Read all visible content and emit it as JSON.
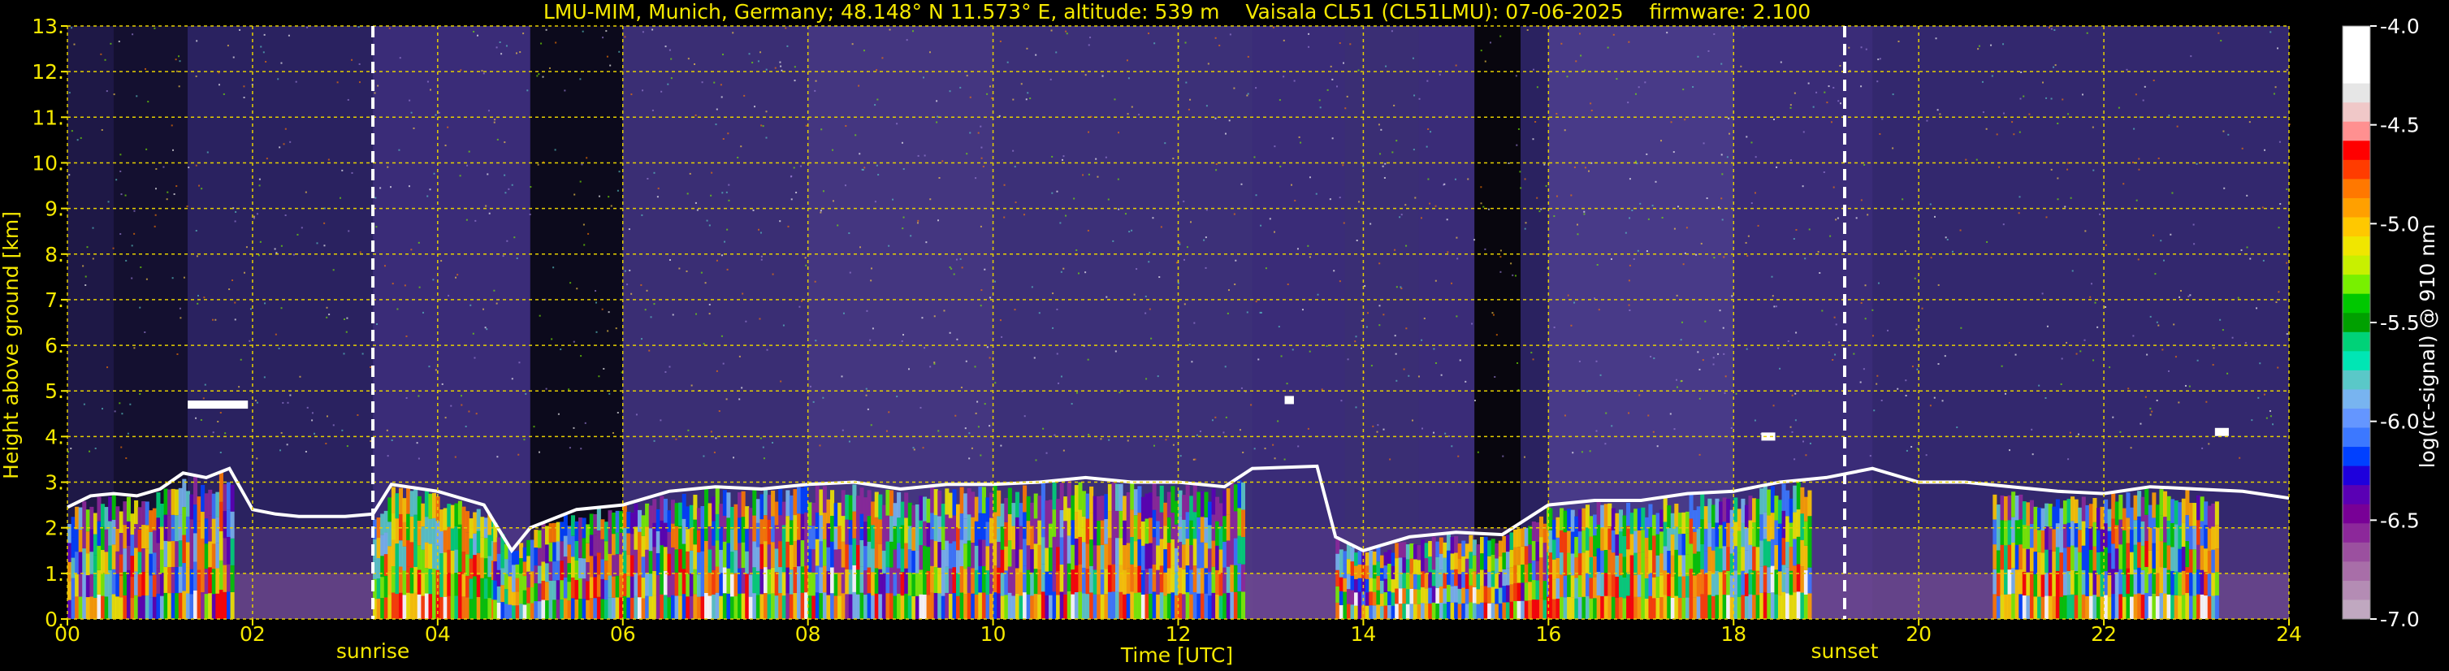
{
  "chart_data": {
    "type": "heatmap",
    "title": "LMU-MIM, Munich, Germany; 48.148° N 11.573° E, altitude: 539 m    Vaisala CL51 (CL51LMU): 07-06-2025    firmware: 2.100",
    "xlabel": "Time [UTC]",
    "ylabel": "Height above ground [km]",
    "xlim": [
      0,
      24
    ],
    "ylim": [
      0,
      13
    ],
    "x_ticks": [
      "00",
      "02",
      "04",
      "06",
      "08",
      "10",
      "12",
      "14",
      "16",
      "18",
      "20",
      "22",
      "24"
    ],
    "y_ticks": [
      "0.",
      "1.",
      "2.",
      "3.",
      "4.",
      "5.",
      "6.",
      "7.",
      "8.",
      "9.",
      "10.",
      "11.",
      "12.",
      "13."
    ],
    "grid": true,
    "colorbar": {
      "label": "log(rc-signal) @ 910 nm",
      "range": [
        -7.0,
        -4.0
      ],
      "ticks": [
        "-4.0",
        "-4.5",
        "-5.0",
        "-5.5",
        "-6.0",
        "-6.5",
        "-7.0"
      ],
      "colors": [
        "#ffffff",
        "#ffffff",
        "#ffffff",
        "#e6e6e6",
        "#f0c8c8",
        "#ff9090",
        "#ff0000",
        "#ff3c00",
        "#ff7800",
        "#ffa000",
        "#ffc800",
        "#f0e600",
        "#c8f000",
        "#78f000",
        "#00c800",
        "#00a000",
        "#00d278",
        "#00e6b4",
        "#5ac8c8",
        "#78b4f0",
        "#6496ff",
        "#3c78ff",
        "#0040ff",
        "#1e00dc",
        "#5a00b4",
        "#780096",
        "#8c289a",
        "#9b509f",
        "#a86ea8",
        "#b48cb4",
        "#c0a8c0"
      ]
    },
    "annotations": [
      {
        "label": "sunrise",
        "x": 3.3
      },
      {
        "label": "sunset",
        "x": 19.2
      }
    ],
    "cloud_layer_km": [
      {
        "t": 0.0,
        "h": 2.45
      },
      {
        "t": 0.25,
        "h": 2.7
      },
      {
        "t": 0.5,
        "h": 2.75
      },
      {
        "t": 0.75,
        "h": 2.7
      },
      {
        "t": 1.0,
        "h": 2.85
      },
      {
        "t": 1.25,
        "h": 3.2
      },
      {
        "t": 1.5,
        "h": 3.1
      },
      {
        "t": 1.75,
        "h": 3.3
      },
      {
        "t": 2.0,
        "h": 2.4
      },
      {
        "t": 2.25,
        "h": 2.3
      },
      {
        "t": 2.5,
        "h": 2.25
      },
      {
        "t": 3.0,
        "h": 2.25
      },
      {
        "t": 3.3,
        "h": 2.3
      },
      {
        "t": 3.5,
        "h": 2.95
      },
      {
        "t": 4.0,
        "h": 2.8
      },
      {
        "t": 4.5,
        "h": 2.5
      },
      {
        "t": 4.8,
        "h": 1.5
      },
      {
        "t": 5.0,
        "h": 2.0
      },
      {
        "t": 5.5,
        "h": 2.4
      },
      {
        "t": 6.0,
        "h": 2.5
      },
      {
        "t": 6.5,
        "h": 2.8
      },
      {
        "t": 7.0,
        "h": 2.9
      },
      {
        "t": 7.5,
        "h": 2.85
      },
      {
        "t": 8.0,
        "h": 2.95
      },
      {
        "t": 8.5,
        "h": 3.0
      },
      {
        "t": 9.0,
        "h": 2.85
      },
      {
        "t": 9.5,
        "h": 2.95
      },
      {
        "t": 10.0,
        "h": 2.95
      },
      {
        "t": 10.5,
        "h": 3.0
      },
      {
        "t": 11.0,
        "h": 3.1
      },
      {
        "t": 11.5,
        "h": 3.0
      },
      {
        "t": 12.0,
        "h": 3.0
      },
      {
        "t": 12.5,
        "h": 2.9
      },
      {
        "t": 12.8,
        "h": 3.3
      },
      {
        "t": 13.5,
        "h": 3.35
      },
      {
        "t": 13.7,
        "h": 1.8
      },
      {
        "t": 14.0,
        "h": 1.5
      },
      {
        "t": 14.5,
        "h": 1.8
      },
      {
        "t": 15.0,
        "h": 1.9
      },
      {
        "t": 15.5,
        "h": 1.85
      },
      {
        "t": 16.0,
        "h": 2.5
      },
      {
        "t": 16.5,
        "h": 2.6
      },
      {
        "t": 17.0,
        "h": 2.6
      },
      {
        "t": 17.5,
        "h": 2.75
      },
      {
        "t": 18.0,
        "h": 2.8
      },
      {
        "t": 18.5,
        "h": 3.0
      },
      {
        "t": 19.0,
        "h": 3.1
      },
      {
        "t": 19.5,
        "h": 3.3
      },
      {
        "t": 20.0,
        "h": 3.0
      },
      {
        "t": 20.5,
        "h": 3.0
      },
      {
        "t": 21.0,
        "h": 2.9
      },
      {
        "t": 21.5,
        "h": 2.8
      },
      {
        "t": 22.0,
        "h": 2.75
      },
      {
        "t": 22.5,
        "h": 2.9
      },
      {
        "t": 23.0,
        "h": 2.85
      },
      {
        "t": 23.5,
        "h": 2.8
      },
      {
        "t": 24.0,
        "h": 2.65
      }
    ],
    "elevated_features": [
      {
        "t_start": 1.3,
        "t_end": 1.95,
        "h": 4.7
      },
      {
        "t_start": 13.15,
        "t_end": 13.25,
        "h": 4.8
      },
      {
        "t_start": 23.2,
        "t_end": 23.35,
        "h": 4.1
      },
      {
        "t_start": 18.3,
        "t_end": 18.45,
        "h": 4.0
      }
    ]
  }
}
